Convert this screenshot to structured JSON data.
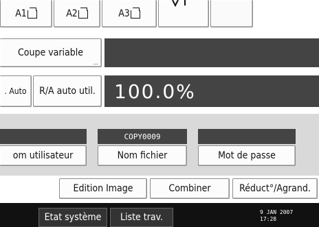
{
  "paper": {
    "a1_label": "A1",
    "a2_label": "A2",
    "a3_label": "A3"
  },
  "variable_cut_label": "Coupe variable",
  "ratio": {
    "auto_label": ". Auto",
    "user_auto_label": "R/A auto util.",
    "value": "100.0%"
  },
  "fields": {
    "user_name_label": "om utilisateur",
    "file_name_value": "COPY0009",
    "file_name_label": "Nom fichier",
    "password_label": "Mot de passe"
  },
  "toolbar": {
    "edit_image_label": "Edition Image",
    "combine_label": "Combiner",
    "reduce_enlarge_label": "Réduct°/Agrand."
  },
  "status": {
    "system_status_label": "Etat système",
    "job_list_label": "Liste trav.",
    "date": "9  JAN  2007",
    "time": "17:28"
  },
  "colors": {
    "dark_panel": "#444444",
    "status_bar": "#111111"
  },
  "icons": [
    "paper-orientation-icon",
    "more-options-icon"
  ]
}
